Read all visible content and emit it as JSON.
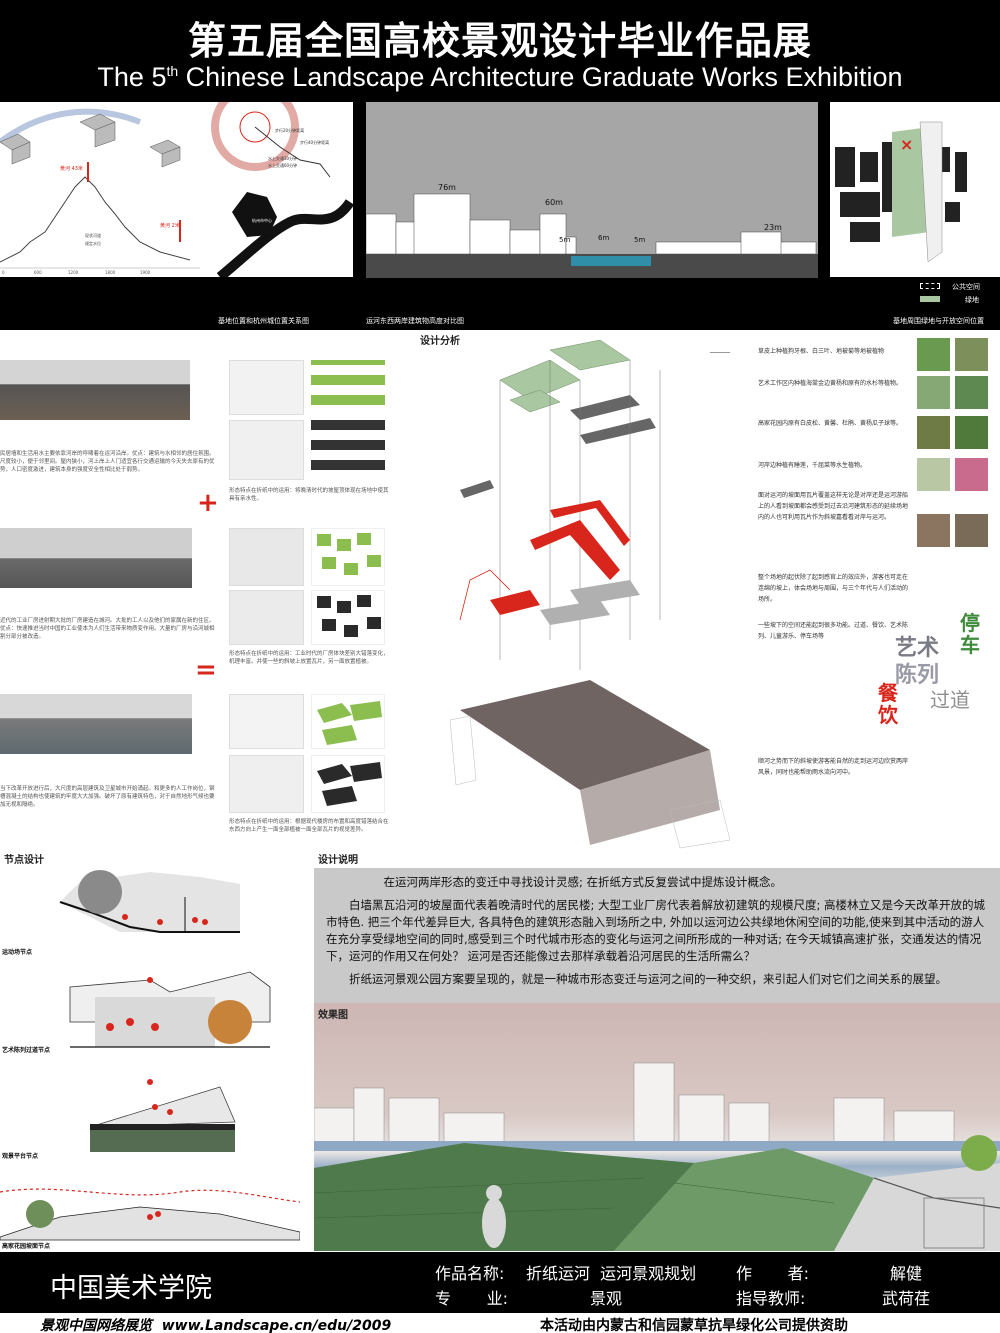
{
  "header": {
    "title_cn": "第五届全国高校景观设计毕业作品展",
    "title_en_pre": "The 5",
    "title_en_sup": "th",
    "title_en_post": " Chinese Landscape Architecture Graduate Works Exhibition"
  },
  "top_panels": {
    "map": {
      "label_h1": "黄河 43米",
      "label_h2": "黄河 2米",
      "legend_1": "现状河道",
      "legend_2": "规定水位",
      "city_center": "杭州市中心",
      "axis_ticks": [
        "0",
        "600",
        "1200",
        "1800",
        "1900"
      ],
      "ring_labels": [
        "步行20分钟距离",
        "步行40分钟距离",
        "水上交通30分钟",
        "水上交通60分钟"
      ],
      "caption": "基地位置和杭州城位置关系图"
    },
    "skyline": {
      "heights": [
        "76m",
        "60m",
        "5m",
        "6m",
        "5m",
        "23m"
      ],
      "caption": "运河东西两岸建筑物高度对比图"
    },
    "site": {
      "legend": [
        "公共空间",
        "绿地"
      ],
      "caption": "基地周围绿地与开放空间位置"
    }
  },
  "design_analysis": {
    "title": "设计分析",
    "rows": [
      {
        "text": "民居墙和生活用水主要依靠河岸的呼啸着在运河沿岸。优点：建筑与水相邻的居住氛围。尺度较小，便于邻里间。屋内狭小，河上岸上人门适宜各行交通运输的今天失去原有的优势，人口密度激进，建筑本身的强度安全性相比处于弱势。",
        "fold_text": "形态特点在折纸中的运用：将晚清时代的坡屋顶体现在场地中使其具有亲水性。"
      },
      {
        "text": "近代的工业厂房进射期大批的厂房建造在城河。大批的工人以及他们的家属在新的住区。优点：快速推进当时中国的工业使本为人们生活带来物质变作用。大量的厂房与沿河城相割分部分被改造。",
        "fold_text": "形态特点在折纸中的运用：工业时代的厂房体块差别大错落变化，机理丰富。并使一些的斜坡上放置瓦片，另一面放置植被。"
      },
      {
        "text": "当下改革开放进行后，大尺度的高层建筑及卫星城市开始涌起。和更多的人工作岗位，钢槽混凝土的结构也使建筑的牢度大大加强。破坏了原有建筑特色，对于自然地形气候也要加无视和隔绝。",
        "fold_text": "形态特点在折纸中的运用：根据现代楼房的布置和高度错落结合在东西方向上产生一面全部植被一面全部瓦片的视觉差异。"
      }
    ],
    "plus": "+",
    "equals": "=",
    "notes": [
      "草皮上种植狗牙根、白三叶、地被菊等地被植物",
      "艺术工作区内种植海棠金边黄杨和原有的水杉等植物。",
      "高家花园内原有白皮松、黄馨、杜鹃、黄杨瓜子球等。",
      "河岸边种植有睡莲，千屈菜等水生植物。",
      "面对运河的坡面用瓦片覆盖这样无论是对岸还是运河游船上的人看到坡面都会感受到过去沿河建筑形态的延续场地内的人也可利用瓦片作为斜坡嘉看看对岸与运河。",
      "整个场地的起伏除了起到感官上的效应外，游客也可走在连绵的坡上，体会场地与周围，与三个年代与人们活动的场所。",
      "一些坡下的空间还能起到很多功能。过道、餐饮、艺术陈列、儿童游乐、停车场等",
      "顺河之势而下的斜坡使游客能自然的走到运河边欣赏两岸风景，同时也能帮助雨水流向河中。"
    ],
    "function_words": [
      "艺术",
      "陈列",
      "停车",
      "过道",
      "餐饮"
    ]
  },
  "node_design": {
    "title": "节点设计",
    "nodes": [
      "运动场节点",
      "艺术陈列过道节点",
      "观景平台节点",
      "高家花园坡面节点"
    ]
  },
  "design_description": {
    "title": "设计说明",
    "paragraphs": [
      "在运河两岸形态的变迁中寻找设计灵感; 在折纸方式反复尝试中提炼设计概念。",
      "白墙黑瓦沿河的坡屋面代表着晚清时代的居民楼; 大型工业厂房代表着解放初建筑的规模尺度; 高楼林立又是今天改革开放的城市特色. 把三个年代差异巨大, 各具特色的建筑形态融入到场所之中, 外加以运河边公共绿地休闲空间的功能,使来到其中活动的游人在充分享受绿地空间的同时,感受到三个时代城市形态的变化与运河之间所形成的一种对话; 在今天城镇高速扩张，交通发达的情况下，运河的作用又在何处？ 运河是否还能像过去那样承载着沿河居民的生活所需么？",
      "折纸运河景观公园方案要呈现的，就是一种城市形态变迁与运河之间的一种交织，来引起人们对它们之间关系的展望。"
    ]
  },
  "render": {
    "title": "效果图"
  },
  "footer": {
    "school": "中国美术学院",
    "work_label": "作品名称:",
    "work_value": "折纸运河  运河景观规划",
    "author_label": "作       者:",
    "author_value": "解健",
    "major_label": "专       业:",
    "major_value": "景观",
    "advisor_label": "指导教师:",
    "advisor_value": "武荷荏",
    "site": "景观中国网络展览  www.Landscape.cn/edu/2009",
    "sponsor": "本活动由内蒙古和信园蒙草抗旱绿化公司提供资助"
  },
  "colors": {
    "accent_red": "#d9261c",
    "green": "#7fb24a",
    "gray_box": "#c9c9c9"
  }
}
